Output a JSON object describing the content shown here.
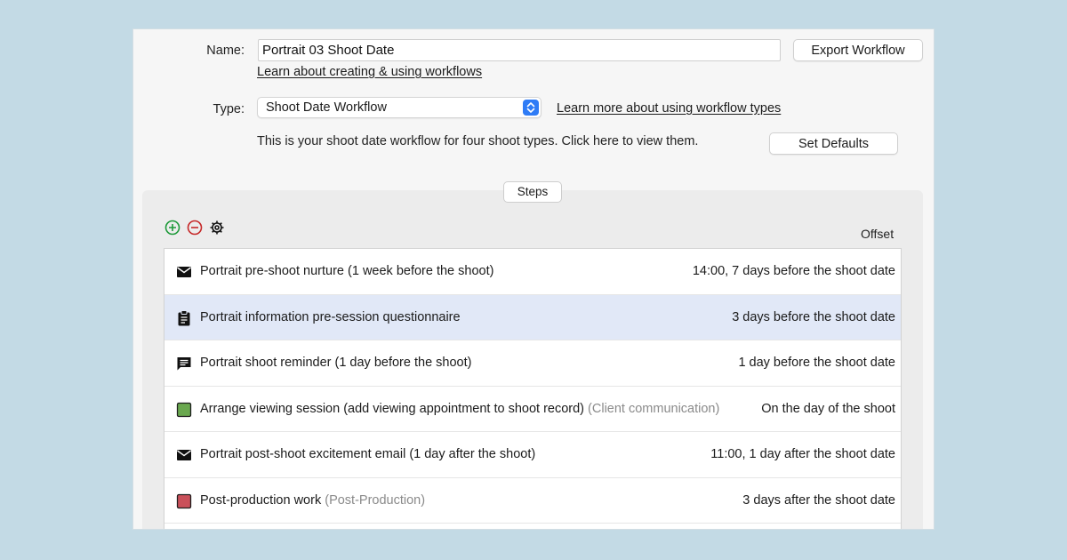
{
  "form": {
    "name_label": "Name:",
    "name_value": "Portrait 03 Shoot Date",
    "export_button": "Export Workflow",
    "learn_workflows_link": "Learn about creating & using workflows",
    "type_label": "Type:",
    "type_value": "Shoot Date Workflow",
    "learn_types_link": "Learn more about using workflow types",
    "info_text": "This is your shoot date workflow for four shoot types. Click here to view them.",
    "set_defaults_button": "Set Defaults"
  },
  "steps": {
    "tab_label": "Steps",
    "offset_header": "Offset",
    "toolbar": {
      "add_icon": "plus-circle-icon",
      "remove_icon": "minus-circle-icon",
      "settings_icon": "gear-icon",
      "add_color": "#1e9a3a",
      "remove_color": "#c62828"
    },
    "rows": [
      {
        "icon": "envelope-icon",
        "title": "Portrait pre-shoot nurture (1 week before the shoot)",
        "category": "",
        "offset": "14:00, 7 days before the shoot date",
        "selected": false
      },
      {
        "icon": "clipboard-icon",
        "title": "Portrait information pre-session questionnaire",
        "category": "",
        "offset": "3 days before the shoot date",
        "selected": true
      },
      {
        "icon": "speech-bubble-icon",
        "title": "Portrait shoot reminder (1 day before the shoot)",
        "category": "",
        "offset": "1 day before the shoot date",
        "selected": false
      },
      {
        "icon": "green-square-icon",
        "title": "Arrange viewing session (add viewing appointment to shoot record)",
        "category": "(Client communication)",
        "offset": "On the day of the shoot",
        "selected": false
      },
      {
        "icon": "envelope-icon",
        "title": "Portrait post-shoot excitement email (1 day after the shoot)",
        "category": "",
        "offset": "11:00, 1 day after the shoot date",
        "selected": false
      },
      {
        "icon": "red-square-icon",
        "title": "Post-production work",
        "category": "(Post-Production)",
        "offset": "3 days after the shoot date",
        "selected": false
      }
    ]
  },
  "colors": {
    "background": "#c3dae5",
    "selected_row": "#e1e8f7",
    "select_accent": "#2f7cf6",
    "category_green": "#6aa84f",
    "category_red": "#c9505a"
  }
}
